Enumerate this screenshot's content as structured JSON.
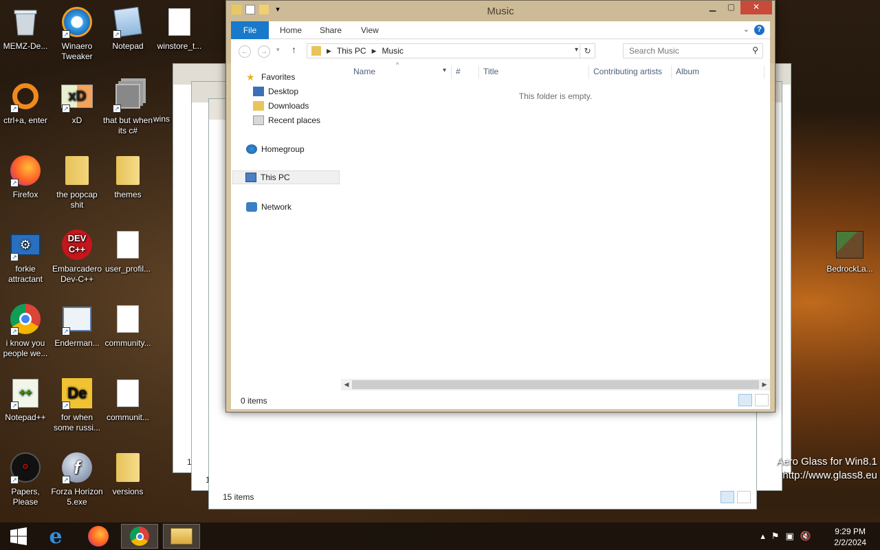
{
  "desktop": {
    "icons": [
      {
        "label": "MEMZ-De...",
        "icon": "recycle-bin-icon"
      },
      {
        "label": "Winaero Tweaker",
        "icon": "winaero-icon"
      },
      {
        "label": "Notepad",
        "icon": "notepad-icon"
      },
      {
        "label": "winstore_t...",
        "icon": "document-icon"
      },
      {
        "label": "ctrl+a, enter",
        "icon": "orange-ring-icon"
      },
      {
        "label": "xD",
        "icon": "xd-icon"
      },
      {
        "label": "that but when its c#",
        "icon": "windows-stack-icon"
      },
      {
        "label": "Firefox",
        "icon": "firefox-icon"
      },
      {
        "label": "the popcap shit",
        "icon": "folder-icon"
      },
      {
        "label": "themes",
        "icon": "folder-icon"
      },
      {
        "label": "forkie attractant",
        "icon": "settings-monitor-icon"
      },
      {
        "label": "Embarcadero Dev-C++",
        "icon": "devcpp-icon"
      },
      {
        "label": "user_profil...",
        "icon": "document-icon"
      },
      {
        "label": "i know you people we...",
        "icon": "chrome-icon"
      },
      {
        "label": "Enderman...",
        "icon": "image-window-icon"
      },
      {
        "label": "community...",
        "icon": "document-icon"
      },
      {
        "label": "Notepad++",
        "icon": "notepadpp-icon"
      },
      {
        "label": "for when some russi...",
        "icon": "de-icon"
      },
      {
        "label": "communit...",
        "icon": "document-icon"
      },
      {
        "label": "Papers, Please",
        "icon": "papers-please-icon"
      },
      {
        "label": "Forza Horizon 5.exe",
        "icon": "flash-icon"
      },
      {
        "label": "versions",
        "icon": "folder-icon"
      },
      {
        "label": "BedrockLa...",
        "icon": "minecraft-bedrock-icon"
      }
    ],
    "partial_label": "wins"
  },
  "background_windows": {
    "status_count": "15 items",
    "partial_count_a": "1",
    "partial_count_b": "1"
  },
  "window": {
    "title": "Music",
    "ribbon": {
      "file": "File",
      "home": "Home",
      "share": "Share",
      "view": "View",
      "help": "?"
    },
    "address": {
      "segments": [
        "This PC",
        "Music"
      ]
    },
    "search_placeholder": "Search Music",
    "nav": {
      "favorites": "Favorites",
      "desktop": "Desktop",
      "downloads": "Downloads",
      "recent": "Recent places",
      "homegroup": "Homegroup",
      "this_pc": "This PC",
      "network": "Network"
    },
    "columns": {
      "name": "Name",
      "number": "#",
      "title": "Title",
      "artists": "Contributing artists",
      "album": "Album"
    },
    "empty_message": "This folder is empty.",
    "status_count": "0 items"
  },
  "watermark": {
    "line1": "Aero Glass for Win8.1",
    "line2": "http://www.glass8.eu"
  },
  "taskbar": {
    "items": [
      "start-icon",
      "internet-explorer-icon",
      "firefox-icon",
      "chrome-icon",
      "file-explorer-icon"
    ],
    "time": "9:29 PM",
    "date": "2/2/2024"
  }
}
